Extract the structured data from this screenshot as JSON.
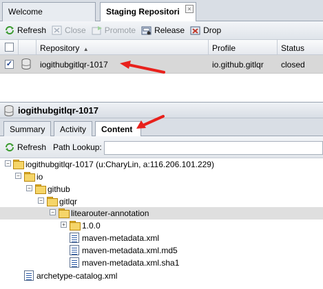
{
  "top_tabs": [
    {
      "label": "Welcome"
    },
    {
      "label": "Staging Repositori",
      "close": "×"
    }
  ],
  "toolbar": {
    "refresh": "Refresh",
    "close": "Close",
    "promote": "Promote",
    "release": "Release",
    "drop": "Drop"
  },
  "grid": {
    "headers": {
      "repository": "Repository",
      "repository_sort": "▲",
      "profile": "Profile",
      "status": "Status"
    },
    "row": {
      "repository": "iogithubgitlqr-1017",
      "profile": "io.github.gitlqr",
      "status": "closed",
      "checked": "✓"
    }
  },
  "detail": {
    "title": "iogithubgitlqr-1017",
    "tabs": [
      "Summary",
      "Activity",
      "Content"
    ],
    "active_tab": "Content",
    "refresh": "Refresh",
    "path_lookup_label": "Path Lookup:",
    "path_lookup_value": ""
  },
  "tree": {
    "root": "iogithubgitlqr-1017 (u:CharyLin, a:116.206.101.229)",
    "io": "io",
    "github": "github",
    "gitlqr": "gitlqr",
    "annotation": "litearouter-annotation",
    "version": "1.0.0",
    "file1": "maven-metadata.xml",
    "file2": "maven-metadata.xml.md5",
    "file3": "maven-metadata.xml.sha1",
    "catalog": "archetype-catalog.xml",
    "collapse_sign": "−",
    "expand_sign": "+"
  },
  "colors": {
    "arrow": "#e8211c",
    "selected_row": "#d8d8d8",
    "refresh_green": "#3a9a2e"
  }
}
